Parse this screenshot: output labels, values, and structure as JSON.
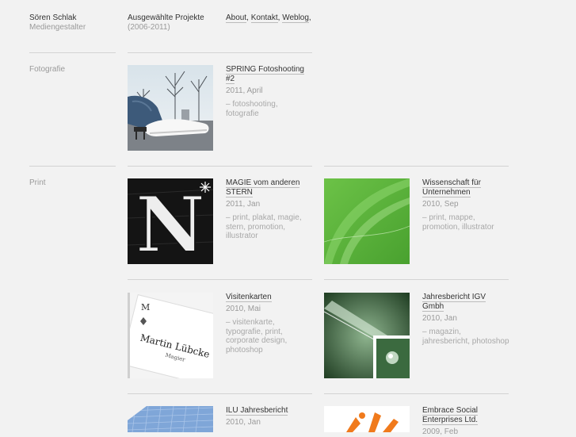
{
  "header": {
    "name": "Sören Schlak",
    "role": "Mediengestalter",
    "projects_title": "Ausgewählte Projekte",
    "projects_range": "(2006-2011)",
    "nav": [
      {
        "label": "About",
        "sep": ","
      },
      {
        "label": "Kontakt",
        "sep": ","
      },
      {
        "label": "Weblog",
        "sep": ","
      }
    ]
  },
  "sections": [
    {
      "label": "Fotografie"
    },
    {
      "label": "Print"
    }
  ],
  "projects": [
    {
      "title": "SPRING Fotoshooting #2",
      "date": "2011, April",
      "tags": "– fotoshooting, fotografie"
    },
    {
      "title": "MAGIE vom anderen STERN",
      "date": "2011, Jan",
      "tags": "– print, plakat, magie, stern, promotion, illustrator"
    },
    {
      "title": "Wissenschaft für Unternehmen",
      "date": "2010, Sep",
      "tags": "– print, mappe, promotion, illustrator"
    },
    {
      "title": "Visitenkarten",
      "date": "2010, Mai",
      "tags": "– visitenkarte, typografie, print, corporate design, photoshop"
    },
    {
      "title": "Jahresbericht IGV Gmbh",
      "date": "2010, Jan",
      "tags": "– magazin, jahresbericht, photoshop"
    },
    {
      "title": "ILU Jahresbericht",
      "date": "2010, Jan",
      "tags": ""
    },
    {
      "title": "Embrace Social Enterprises Ltd.",
      "date": "2009, Feb",
      "tags": ""
    }
  ],
  "thumb_text": {
    "letter": "N",
    "card_initial": "M",
    "card_name": "Martin Lübcke",
    "card_role": "Magier"
  }
}
